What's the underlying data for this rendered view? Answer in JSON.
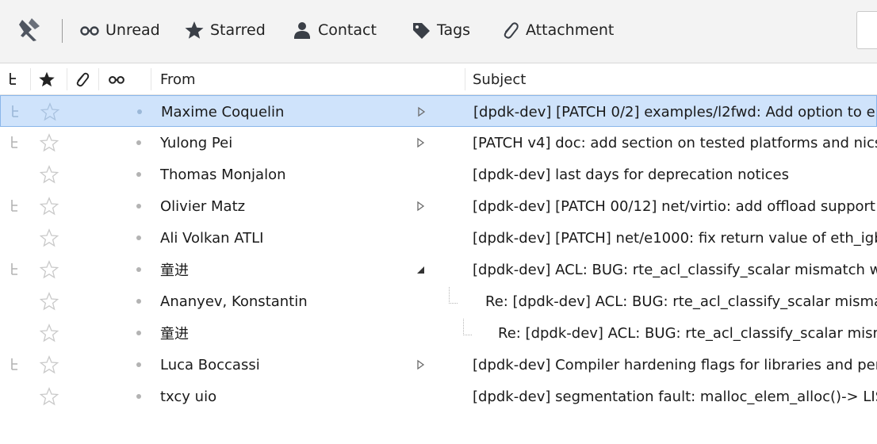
{
  "toolbar": {
    "filters": [
      {
        "label": "Unread",
        "icon": "unread-glasses-icon"
      },
      {
        "label": "Starred",
        "icon": "star-icon"
      },
      {
        "label": "Contact",
        "icon": "contact-person-icon"
      },
      {
        "label": "Tags",
        "icon": "tag-icon"
      },
      {
        "label": "Attachment",
        "icon": "paperclip-icon"
      }
    ]
  },
  "columns": {
    "from": "From",
    "subject": "Subject"
  },
  "messages": [
    {
      "from": "Maxime Coquelin",
      "subject": "[dpdk-dev] [PATCH 0/2] examples/l2fwd: Add option to e",
      "thread": "collapsed",
      "selected": true
    },
    {
      "from": "Yulong Pei",
      "subject": "[PATCH v4] doc: add section on tested platforms and nics",
      "thread": "collapsed"
    },
    {
      "from": "Thomas Monjalon",
      "subject": "[dpdk-dev] last days for deprecation notices",
      "thread": "none"
    },
    {
      "from": "Olivier Matz",
      "subject": "[dpdk-dev] [PATCH 00/12] net/virtio: add offload support",
      "thread": "collapsed"
    },
    {
      "from": "Ali Volkan ATLI",
      "subject": "[dpdk-dev] [PATCH] net/e1000: fix return value of eth_igb",
      "thread": "none"
    },
    {
      "from": "童进",
      "subject": "[dpdk-dev] ACL: BUG: rte_acl_classify_scalar mismatch wh",
      "thread": "expanded"
    },
    {
      "from": "Ananyev, Konstantin",
      "subject": "Re: [dpdk-dev] ACL: BUG: rte_acl_classify_scalar mismat",
      "thread": "child",
      "depth": 1
    },
    {
      "from": "童进",
      "subject": "Re: [dpdk-dev] ACL: BUG: rte_acl_classify_scalar mism",
      "thread": "child",
      "depth": 2
    },
    {
      "from": "Luca Boccassi",
      "subject": "[dpdk-dev] Compiler hardening flags for libraries and perf",
      "thread": "collapsed"
    },
    {
      "from": "txcy uio",
      "subject": "[dpdk-dev] segmentation fault: malloc_elem_alloc()-> LIS",
      "thread": "none"
    }
  ],
  "colors": {
    "selected_bg": "#cfe3fb",
    "selected_border": "#8ab6ea",
    "icon_gray": "#c2c2c2"
  }
}
